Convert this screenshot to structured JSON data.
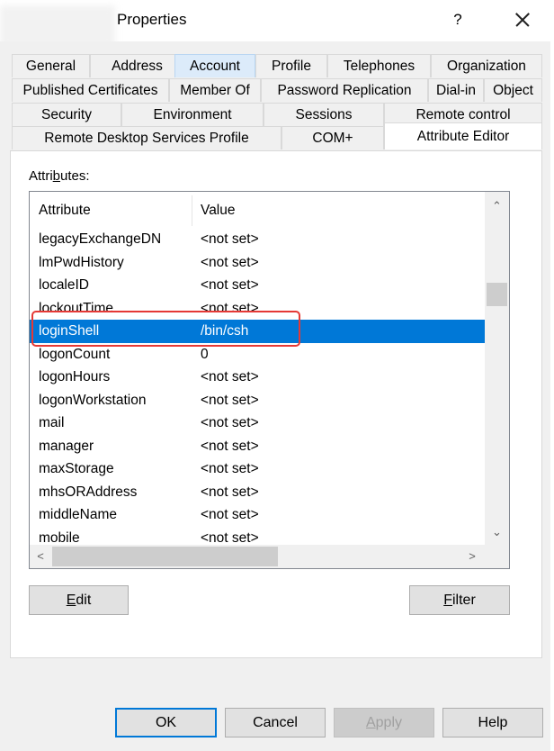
{
  "window": {
    "title": "Properties",
    "help": "?"
  },
  "tabs": {
    "row1": [
      "General",
      "Address",
      "Account",
      "Profile",
      "Telephones",
      "Organization"
    ],
    "row2": [
      "Published Certificates",
      "Member Of",
      "Password Replication",
      "Dial-in",
      "Object"
    ],
    "row3": [
      "Security",
      "Environment",
      "Sessions",
      "Remote control"
    ],
    "row4": [
      "Remote Desktop Services Profile",
      "COM+",
      "Attribute Editor"
    ]
  },
  "panel": {
    "attributes_label_pre": "Attri",
    "attributes_label_ul": "b",
    "attributes_label_post": "utes:"
  },
  "list": {
    "columns": [
      "Attribute",
      "Value"
    ],
    "rows": [
      {
        "attribute": "legacyExchangeDN",
        "value": "<not set>"
      },
      {
        "attribute": "lmPwdHistory",
        "value": "<not set>"
      },
      {
        "attribute": "localeID",
        "value": "<not set>"
      },
      {
        "attribute": "lockoutTime",
        "value": "<not set>"
      },
      {
        "attribute": "loginShell",
        "value": "/bin/csh"
      },
      {
        "attribute": "logonCount",
        "value": "0"
      },
      {
        "attribute": "logonHours",
        "value": "<not set>"
      },
      {
        "attribute": "logonWorkstation",
        "value": "<not set>"
      },
      {
        "attribute": "mail",
        "value": "<not set>"
      },
      {
        "attribute": "manager",
        "value": "<not set>"
      },
      {
        "attribute": "maxStorage",
        "value": "<not set>"
      },
      {
        "attribute": "mhsORAddress",
        "value": "<not set>"
      },
      {
        "attribute": "middleName",
        "value": "<not set>"
      },
      {
        "attribute": "mobile",
        "value": "<not set>"
      }
    ],
    "selected_attribute": "loginShell"
  },
  "actions": {
    "edit_ul": "E",
    "edit_rest": "dit",
    "filter_ul": "F",
    "filter_rest": "ilter"
  },
  "footer": {
    "ok": "OK",
    "cancel": "Cancel",
    "apply_ul": "A",
    "apply_rest": "pply",
    "help": "Help"
  },
  "colors": {
    "selection": "#0078d7",
    "highlight_box": "#e53935"
  }
}
